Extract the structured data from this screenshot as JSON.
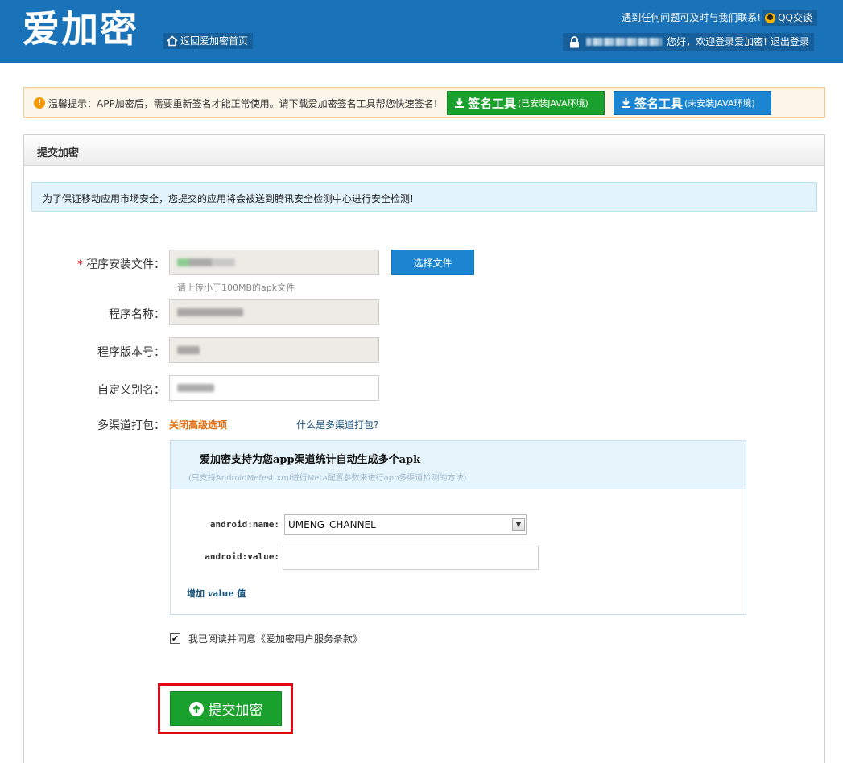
{
  "header": {
    "logo": "爱加密",
    "home_link": "返回爱加密首页",
    "contact_text": "遇到任何问题可及时与我们联系!",
    "qq_label": "QQ交谈",
    "greeting": "您好，欢迎登录爱加密!",
    "logout": "退出登录"
  },
  "notice": {
    "text": "温馨提示：APP加密后，需要重新签名才能正常使用。请下载爱加密签名工具帮您快速签名!",
    "sign_tool_installed": {
      "title": "签名工具",
      "note": "(已安装JAVA环境)"
    },
    "sign_tool_not_installed": {
      "title": "签名工具",
      "note": "(未安装JAVA环境)"
    }
  },
  "panel": {
    "title": "提交加密",
    "info": "为了保证移动应用市场安全，您提交的应用将会被送到腾讯安全检测中心进行安全检测!"
  },
  "form": {
    "file_label": "程序安装文件：",
    "file_required_mark": "*",
    "choose_file": "选择文件",
    "file_hint": "请上传小于100MB的apk文件",
    "app_name_label": "程序名称：",
    "version_label": "程序版本号：",
    "alias_label": "自定义别名：",
    "multichannel_label": "多渠道打包：",
    "advanced_toggle": "关闭高级选项",
    "what_is_multichannel": "什么是多渠道打包?"
  },
  "channel": {
    "title": "爱加密支持为您app渠道统计自动生成多个apk",
    "subtitle": "(只支持AndroidMefest.xml进行Meta配置参数来进行app多渠道检测的方法)",
    "name_label": "android:name:",
    "name_value": "UMENG_CHANNEL",
    "value_label": "android:value:",
    "value_input": "",
    "add_value": "增加 value 值"
  },
  "agreement": {
    "checked": true,
    "text": "我已阅读并同意《爱加密用户服务条款》"
  },
  "submit": {
    "label": "提交加密"
  },
  "colors": {
    "header_bg": "#1a73b8",
    "green_button": "#1aa02c",
    "blue_button": "#1b85d1",
    "highlight_border": "#e30613",
    "advanced_toggle": "#e36b0a"
  }
}
